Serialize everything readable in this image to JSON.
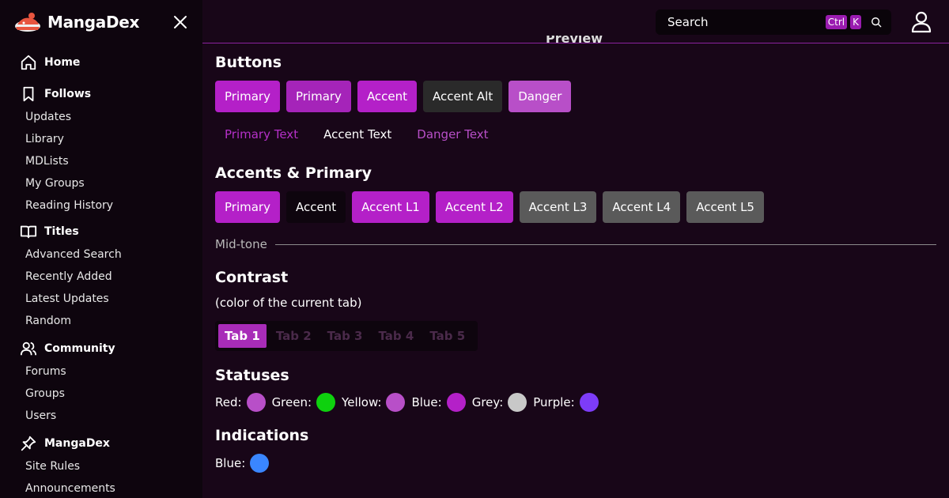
{
  "app": {
    "name": "MangaDex"
  },
  "sidebar": {
    "sections": [
      {
        "label": "Home",
        "icon": "home-icon",
        "items": []
      },
      {
        "label": "Follows",
        "icon": "bookmark-icon",
        "items": [
          "Updates",
          "Library",
          "MDLists",
          "My Groups",
          "Reading History"
        ]
      },
      {
        "label": "Titles",
        "icon": "book-open-icon",
        "items": [
          "Advanced Search",
          "Recently Added",
          "Latest Updates",
          "Random"
        ]
      },
      {
        "label": "Community",
        "icon": "users-icon",
        "items": [
          "Forums",
          "Groups",
          "Users"
        ]
      },
      {
        "label": "MangaDex",
        "icon": "pin-icon",
        "items": [
          "Site Rules",
          "Announcements"
        ]
      }
    ]
  },
  "topbar": {
    "search_label": "Search",
    "kbd_ctrl": "Ctrl",
    "kbd_key": "K"
  },
  "main": {
    "preview_title": "Preview",
    "buttons_title": "Buttons",
    "buttons": [
      {
        "label": "Primary",
        "bg": "#b420c8"
      },
      {
        "label": "Primary",
        "bg": "#a524b9"
      },
      {
        "label": "Accent",
        "bg": "#b420c8"
      },
      {
        "label": "Accent Alt",
        "bg": "#2a2a2a"
      },
      {
        "label": "Danger",
        "bg": "#b84fc8"
      }
    ],
    "text_buttons": [
      {
        "label": "Primary Text",
        "color": "#b530c8"
      },
      {
        "label": "Accent Text",
        "color": "#ffffff"
      },
      {
        "label": "Danger Text",
        "color": "#b84fc8"
      }
    ],
    "accents_title": "Accents & Primary",
    "accents": [
      {
        "label": "Primary",
        "bg": "#b420c8"
      },
      {
        "label": "Accent",
        "bg": "#0e050e"
      },
      {
        "label": "Accent L1",
        "bg": "#b420c8"
      },
      {
        "label": "Accent L2",
        "bg": "#b420c8"
      },
      {
        "label": "Accent L3",
        "bg": "#5a5a5a"
      },
      {
        "label": "Accent L4",
        "bg": "#5a5a5a"
      },
      {
        "label": "Accent L5",
        "bg": "#5a5a5a"
      }
    ],
    "midtone_label": "Mid-tone",
    "contrast_title": "Contrast",
    "contrast_sub": "(color of the current tab)",
    "tabs": [
      "Tab 1",
      "Tab 2",
      "Tab 3",
      "Tab 4",
      "Tab 5"
    ],
    "active_tab": 0,
    "statuses_title": "Statuses",
    "statuses": [
      {
        "label": "Red:",
        "color": "#b84fc8"
      },
      {
        "label": "Green:",
        "color": "#0ed10e"
      },
      {
        "label": "Yellow:",
        "color": "#b84fc8"
      },
      {
        "label": "Blue:",
        "color": "#b420c8"
      },
      {
        "label": "Grey:",
        "color": "#c8c8c8"
      },
      {
        "label": "Purple:",
        "color": "#7d3cf8"
      }
    ],
    "indications_title": "Indications",
    "indications": [
      {
        "label": "Blue:",
        "color": "#3a86ff"
      }
    ]
  }
}
